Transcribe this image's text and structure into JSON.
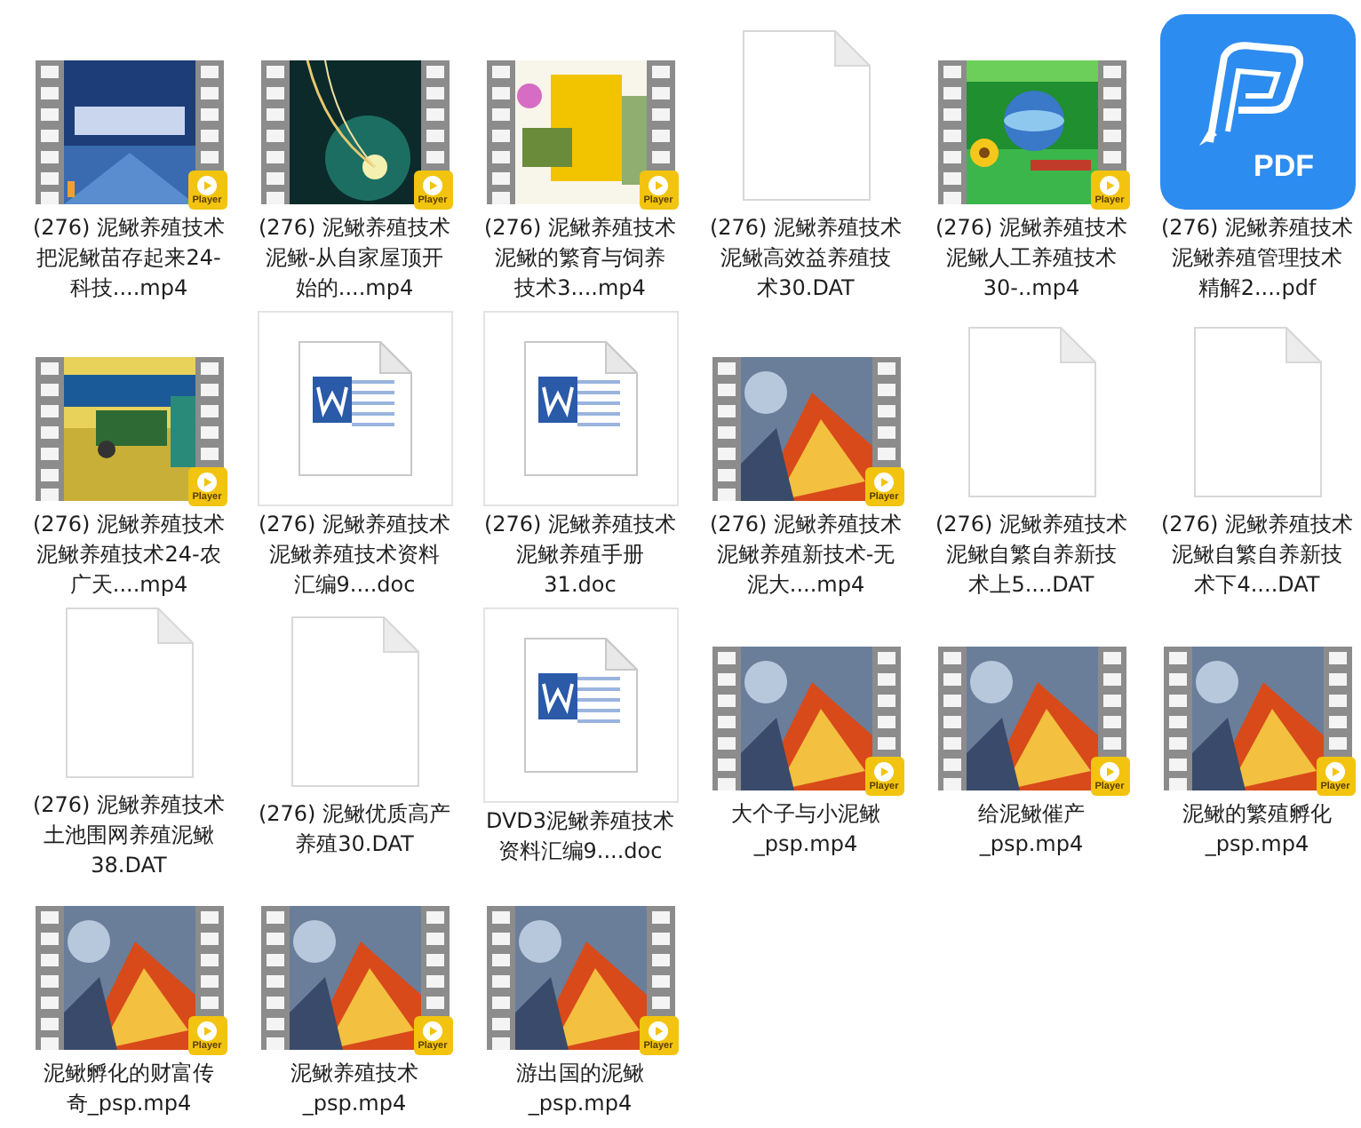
{
  "files": [
    {
      "kind": "video",
      "badge": "Player",
      "name_lines": [
        "(276) 泥鳅养殖技术",
        "把泥鳅苗存起来24-",
        "科技....mp4"
      ]
    },
    {
      "kind": "video",
      "badge": "Player",
      "name_lines": [
        "(276) 泥鳅养殖技术",
        "泥鳅-从自家屋顶开",
        "始的....mp4"
      ]
    },
    {
      "kind": "video",
      "badge": "Player",
      "name_lines": [
        "(276) 泥鳅养殖技术",
        "泥鳅的繁育与饲养",
        "技术3....mp4"
      ]
    },
    {
      "kind": "dat",
      "name_lines": [
        "(276) 泥鳅养殖技术",
        "泥鳅高效益养殖技",
        "术30.DAT"
      ]
    },
    {
      "kind": "video",
      "badge": "Player",
      "name_lines": [
        "(276) 泥鳅养殖技术",
        "泥鳅人工养殖技术",
        "30-..mp4"
      ]
    },
    {
      "kind": "pdf",
      "badge": "PDF",
      "name_lines": [
        "(276) 泥鳅养殖技术",
        "泥鳅养殖管理技术",
        "精解2....pdf"
      ]
    },
    {
      "kind": "video",
      "badge": "Player",
      "name_lines": [
        "(276) 泥鳅养殖技术",
        "泥鳅养殖技术24-农",
        "广天....mp4"
      ]
    },
    {
      "kind": "doc",
      "name_lines": [
        "(276) 泥鳅养殖技术",
        "泥鳅养殖技术资料",
        "汇编9....doc"
      ]
    },
    {
      "kind": "doc",
      "name_lines": [
        "(276) 泥鳅养殖技术",
        "泥鳅养殖手册",
        "31.doc"
      ]
    },
    {
      "kind": "video",
      "badge": "Player",
      "name_lines": [
        "(276) 泥鳅养殖技术",
        "泥鳅养殖新技术-无",
        "泥大....mp4"
      ]
    },
    {
      "kind": "dat",
      "name_lines": [
        "(276) 泥鳅养殖技术",
        "泥鳅自繁自养新技",
        "术上5....DAT"
      ]
    },
    {
      "kind": "dat",
      "name_lines": [
        "(276) 泥鳅养殖技术",
        "泥鳅自繁自养新技",
        "术下4....DAT"
      ]
    },
    {
      "kind": "dat",
      "name_lines": [
        "(276) 泥鳅养殖技术",
        "土池围网养殖泥鳅",
        "38.DAT"
      ]
    },
    {
      "kind": "dat",
      "name_lines": [
        "(276) 泥鳅优质高产",
        "养殖30.DAT"
      ]
    },
    {
      "kind": "doc",
      "name_lines": [
        "DVD3泥鳅养殖技术",
        "资料汇编9....doc"
      ]
    },
    {
      "kind": "video",
      "badge": "Player",
      "name_lines": [
        "大个子与小泥鳅",
        "_psp.mp4"
      ]
    },
    {
      "kind": "video",
      "badge": "Player",
      "name_lines": [
        "给泥鳅催产",
        "_psp.mp4"
      ]
    },
    {
      "kind": "video",
      "badge": "Player",
      "name_lines": [
        "泥鳅的繁殖孵化",
        "_psp.mp4"
      ]
    },
    {
      "kind": "video",
      "badge": "Player",
      "name_lines": [
        "泥鳅孵化的财富传",
        "奇_psp.mp4"
      ]
    },
    {
      "kind": "video",
      "badge": "Player",
      "name_lines": [
        "泥鳅养殖技术",
        "_psp.mp4"
      ]
    },
    {
      "kind": "video",
      "badge": "Player",
      "name_lines": [
        "游出国的泥鳅",
        "_psp.mp4"
      ]
    }
  ]
}
